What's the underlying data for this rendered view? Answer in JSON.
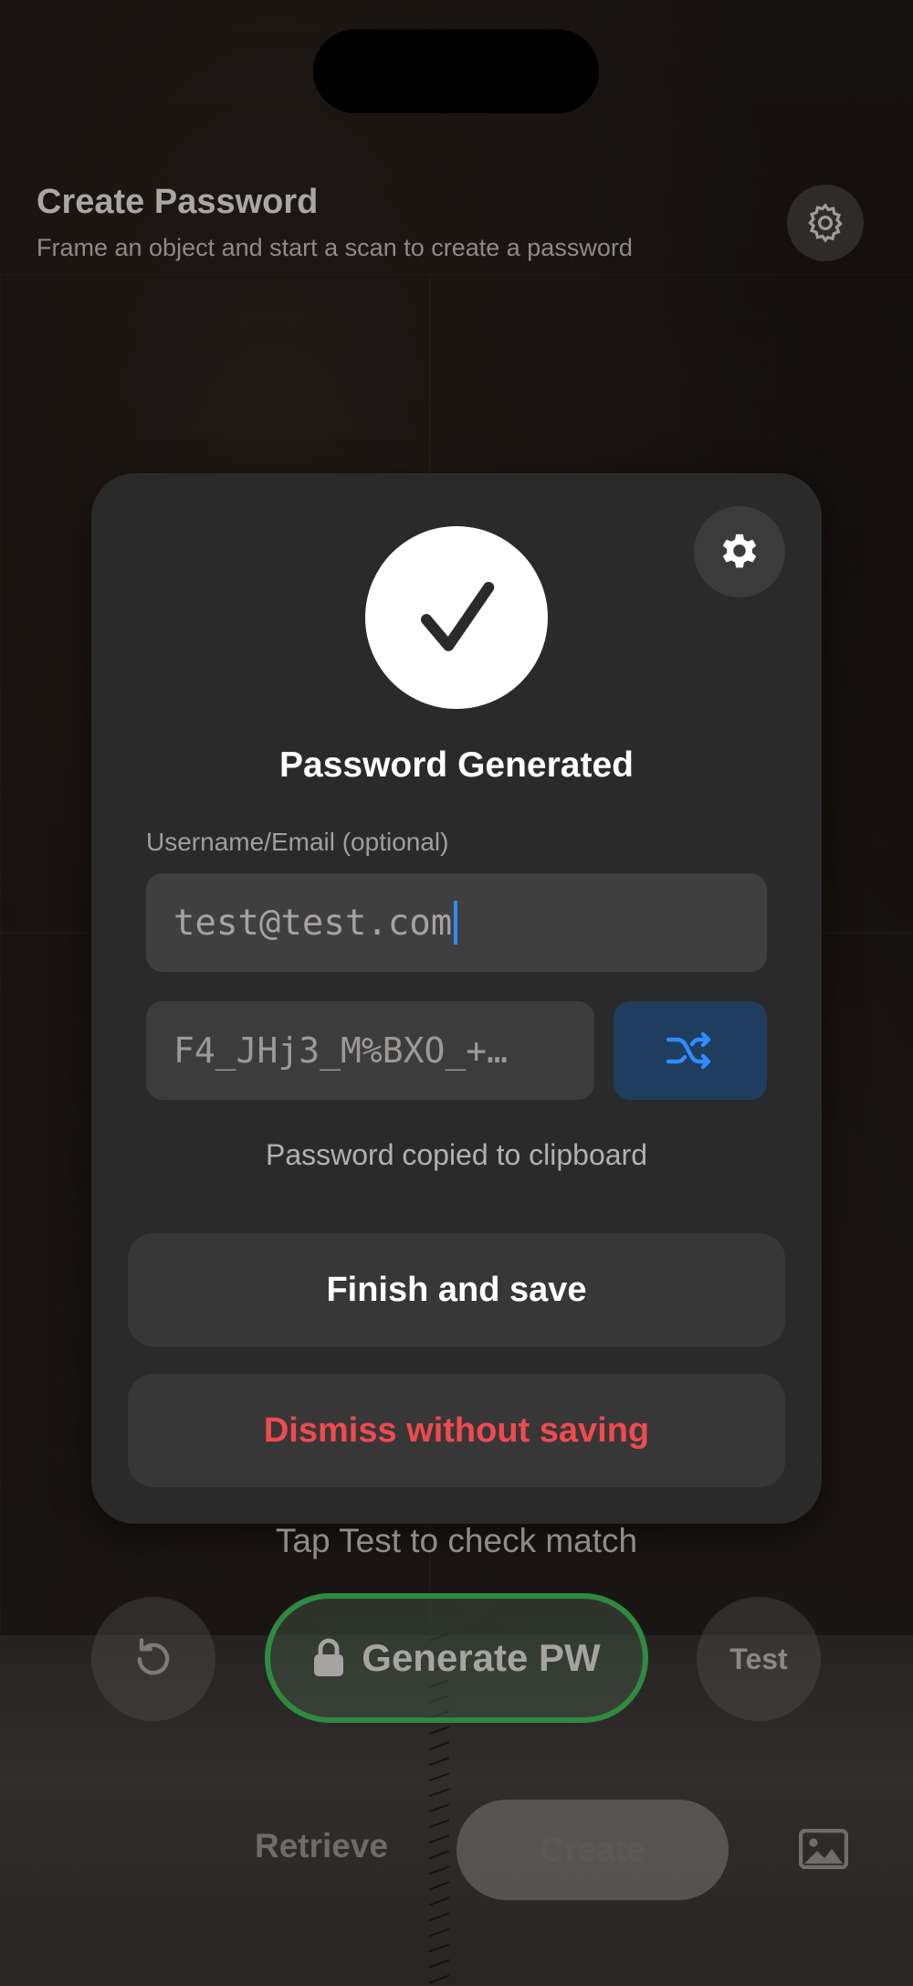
{
  "header": {
    "title": "Create Password",
    "subtitle": "Frame an object and start a scan to create a password",
    "settings_icon": "gear-icon"
  },
  "dialog": {
    "title": "Password Generated",
    "status_icon": "checkmark-icon",
    "settings_icon": "gear-icon",
    "username_label": "Username/Email (optional)",
    "username_value": "test@test.com",
    "password_value": "F4_JHj3_M%BXO_+…",
    "shuffle_icon": "shuffle-icon",
    "copied_note": "Password copied to clipboard",
    "finish_label": "Finish and save",
    "dismiss_label": "Dismiss without saving",
    "colors": {
      "accent": "#2f8cff",
      "danger": "#ef4a4f"
    }
  },
  "scan_controls": {
    "hint": "Tap Test to check match",
    "reset_icon": "reset-icon",
    "generate_label": "Generate PW",
    "lock_icon": "lock-icon",
    "test_label": "Test",
    "generate_color": "#2e8a3e"
  },
  "mode_switch": {
    "retrieve_label": "Retrieve",
    "create_label": "Create",
    "selected": "Create",
    "photo_icon": "photo-icon"
  }
}
